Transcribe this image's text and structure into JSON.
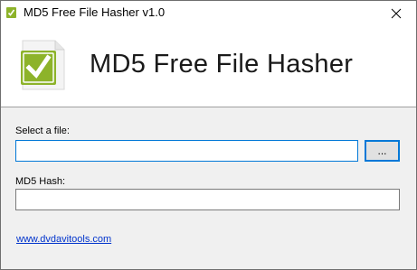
{
  "window": {
    "title": "MD5 Free File Hasher v1.0"
  },
  "banner": {
    "title": "MD5 Free File Hasher",
    "icon": "document-check-icon"
  },
  "form": {
    "file_label": "Select a file:",
    "file_value": "",
    "browse_label": "...",
    "hash_label": "MD5 Hash:",
    "hash_value": ""
  },
  "footer": {
    "link_text": "www.dvdavitools.com"
  },
  "colors": {
    "accent": "#0078d7",
    "check_green": "#8db32a",
    "link": "#0033cc"
  }
}
